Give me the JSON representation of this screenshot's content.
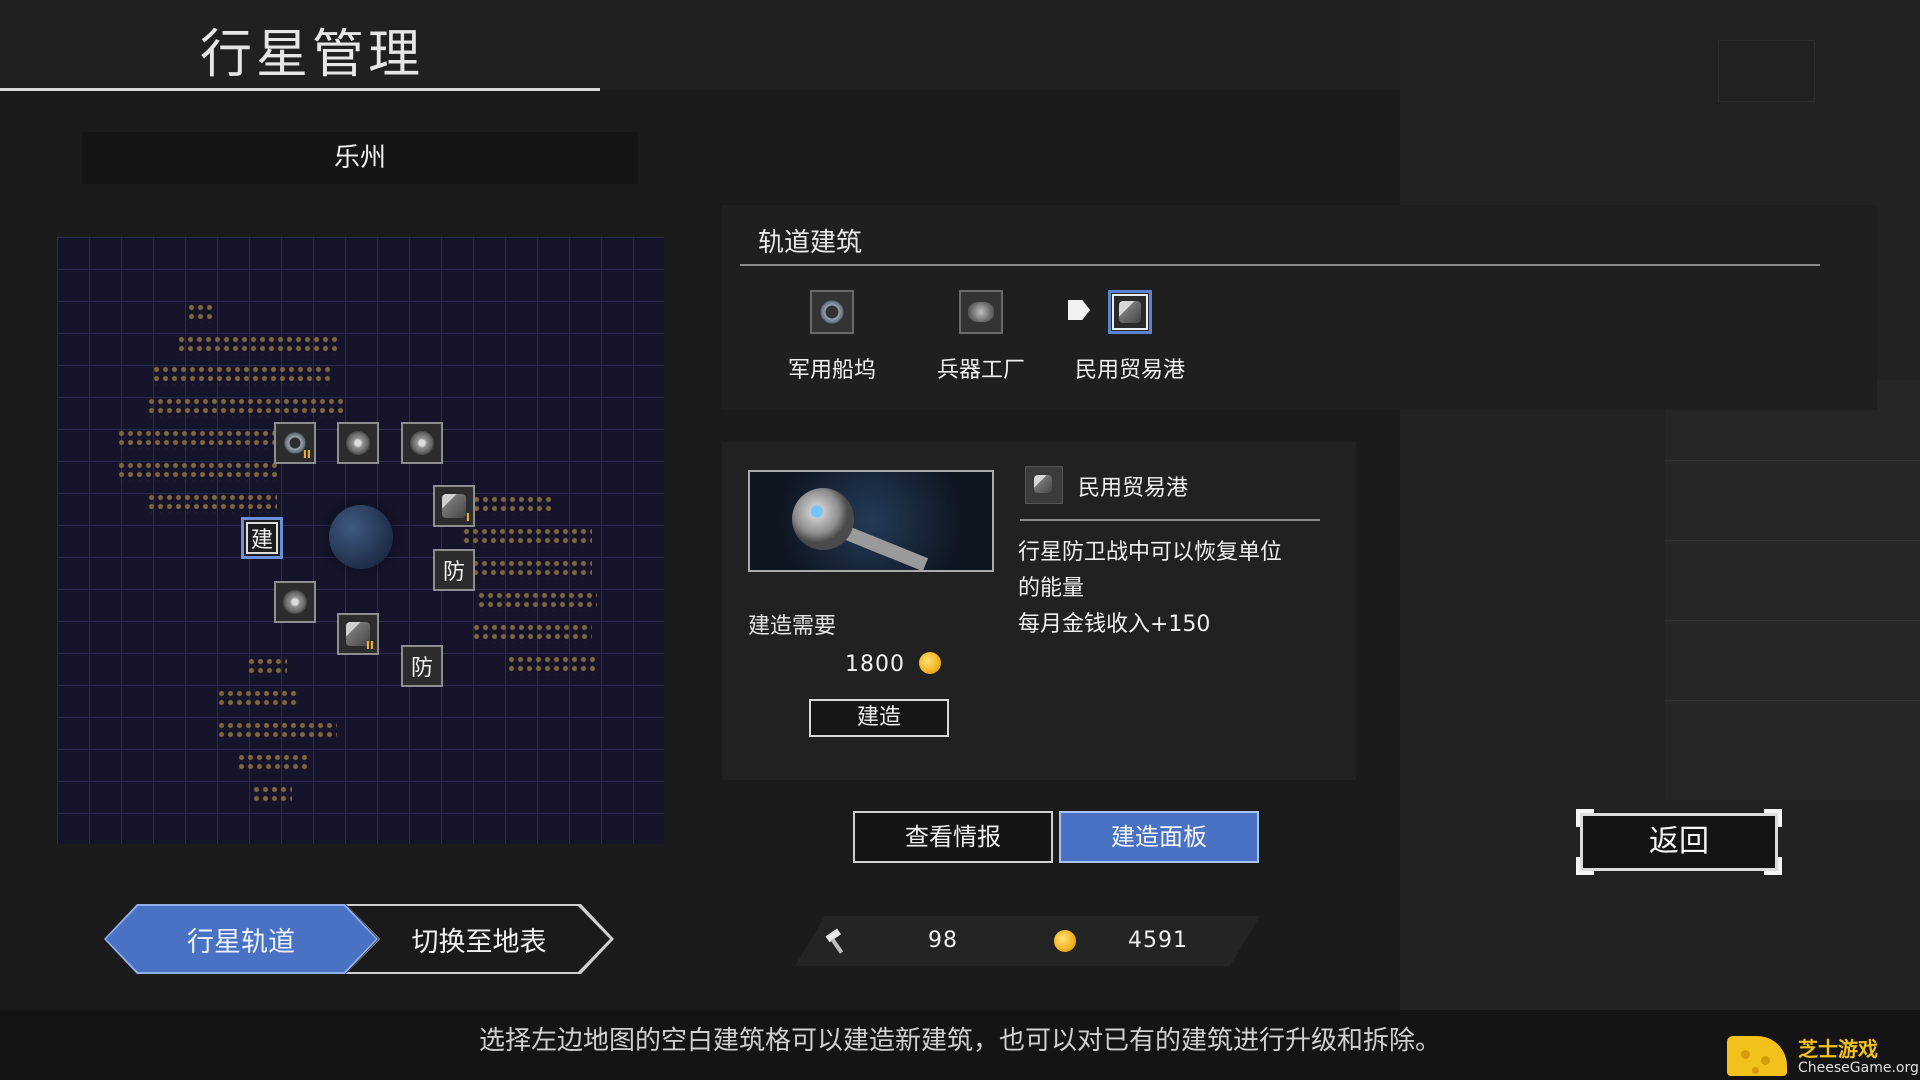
{
  "header": {
    "title": "行星管理"
  },
  "planet": {
    "name": "乐州"
  },
  "map": {
    "slots": [
      {
        "label": "",
        "icon": "orbital-ring-icon",
        "rank": "II"
      },
      {
        "label": "",
        "icon": "gear-icon",
        "rank": ""
      },
      {
        "label": "",
        "icon": "gear-icon",
        "rank": ""
      },
      {
        "label": "",
        "icon": "trade-port-icon",
        "rank": "I"
      },
      {
        "label": "建",
        "icon": "",
        "rank": ""
      },
      {
        "label": "防",
        "icon": "",
        "rank": ""
      },
      {
        "label": "",
        "icon": "gear-icon",
        "rank": ""
      },
      {
        "label": "",
        "icon": "trade-port-icon",
        "rank": "II"
      },
      {
        "label": "防",
        "icon": "",
        "rank": ""
      }
    ]
  },
  "orbital": {
    "title": "轨道建筑",
    "buildings": [
      {
        "label": "军用船坞",
        "icon": "shipyard-icon"
      },
      {
        "label": "兵器工厂",
        "icon": "weapon-factory-icon"
      },
      {
        "label": "民用贸易港",
        "icon": "trade-port-icon",
        "selected": true
      }
    ]
  },
  "detail": {
    "name": "民用贸易港",
    "desc_line1": "行星防卫战中可以恢复单位",
    "desc_line2": "的能量",
    "desc_line3": "每月金钱收入+150",
    "requirement_label": "建造需要",
    "cost": "1800",
    "build_button": "建造"
  },
  "tabs": {
    "info": "查看情报",
    "build_panel": "建造面板"
  },
  "back_button": "返回",
  "view_tabs": {
    "orbit": "行星轨道",
    "surface": "切换至地表"
  },
  "resources": {
    "production": "98",
    "money": "4591"
  },
  "hint": "选择左边地图的空白建筑格可以建造新建筑，也可以对已有的建筑进行升级和拆除。",
  "watermark": {
    "cn": "芝士游戏",
    "en": "CheeseGame.org"
  },
  "colors": {
    "accent": "#4a72c4",
    "gold": "#f2b11f",
    "panel": "#212121",
    "map_bg": "#15142a"
  }
}
